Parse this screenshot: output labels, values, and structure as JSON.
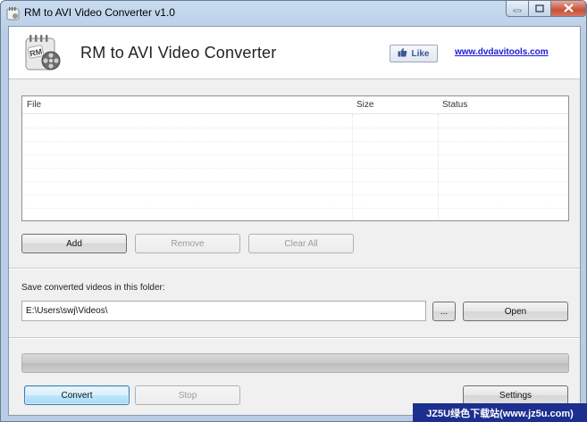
{
  "window": {
    "title": "RM to AVI Video Converter v1.0",
    "controls": {
      "minimize": "—",
      "maximize": "□",
      "close": "✕"
    }
  },
  "header": {
    "logo_text": "RM",
    "app_title": "RM to AVI Video Converter",
    "like_label": "Like",
    "site_link": "www.dvdavitools.com"
  },
  "file_list": {
    "columns": [
      "File",
      "Size",
      "Status"
    ],
    "rows": []
  },
  "list_buttons": {
    "add": "Add",
    "remove": "Remove",
    "clear_all": "Clear All"
  },
  "output": {
    "folder_label": "Save converted videos in this folder:",
    "folder_path": "E:\\Users\\swj\\Videos\\",
    "browse_label": "...",
    "open_label": "Open"
  },
  "progress": {
    "value": 0
  },
  "actions": {
    "convert": "Convert",
    "stop": "Stop",
    "settings": "Settings"
  },
  "watermark": "JZ5U绿色下载站(www.jz5u.com)",
  "colors": {
    "title_bar": "#c9dcf0",
    "link": "#1a1ad6",
    "progress_fill": "#3bb34a",
    "watermark_bg": "#1c2f8f"
  }
}
